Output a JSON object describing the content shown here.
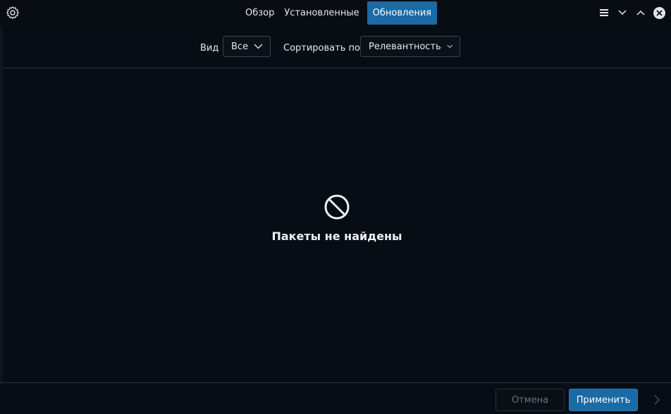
{
  "header": {
    "settings_icon": "gear-icon",
    "tabs": [
      {
        "label": "Обзор",
        "active": false
      },
      {
        "label": "Установленные",
        "active": false
      },
      {
        "label": "Обновления",
        "active": true
      }
    ],
    "controls": [
      "hamburger-menu-icon",
      "chevron-down-icon",
      "chevron-up-icon",
      "close-icon"
    ]
  },
  "toolbar": {
    "view_label": "Вид",
    "view_value": "Все",
    "sort_label": "Сортировать по",
    "sort_value": "Релевантность"
  },
  "main": {
    "empty_icon": "no-entry-icon",
    "empty_message": "Пакеты не найдены"
  },
  "footer": {
    "cancel_label": "Отмена",
    "apply_label": "Применить",
    "next_icon": "chevron-right-icon"
  },
  "colors": {
    "background": "#070d14",
    "accent": "#1b6aa3",
    "text": "#e6e9ec",
    "disabled_text": "#6b737b"
  }
}
